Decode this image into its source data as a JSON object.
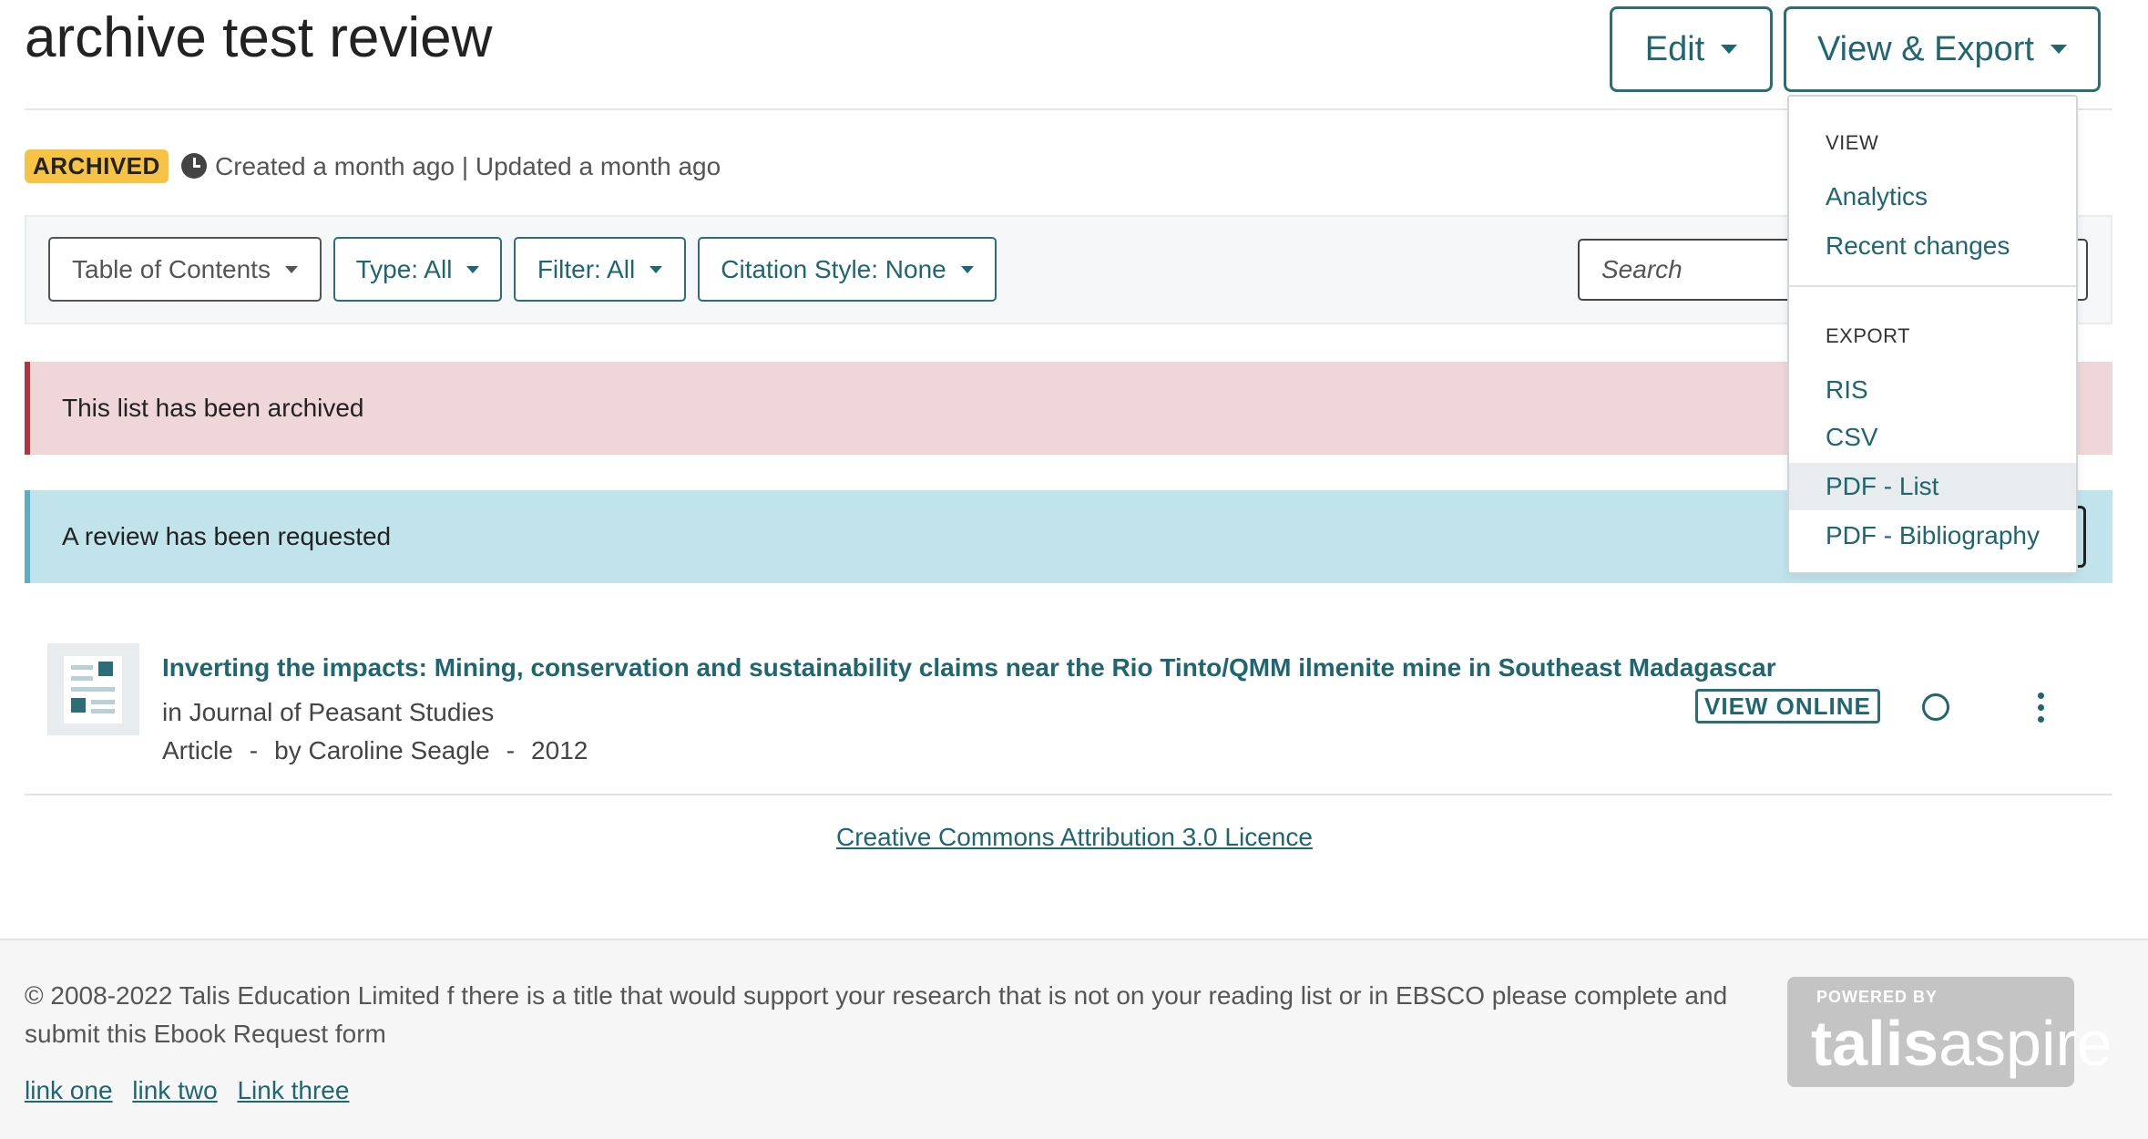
{
  "header": {
    "title": "archive test review",
    "edit_label": "Edit",
    "view_export_label": "View & Export"
  },
  "meta": {
    "badge": "ARCHIVED",
    "timestamps": "Created a month ago | Updated a month ago"
  },
  "toolbar": {
    "toc_label": "Table of Contents",
    "type_label": "Type: All",
    "filter_label": "Filter: All",
    "citation_label": "Citation Style: None",
    "search_placeholder": "Search"
  },
  "alerts": {
    "archived": "This list has been archived",
    "review": "A review has been requested"
  },
  "item": {
    "title": "Inverting the impacts: Mining, conservation and sustainability claims near the Rio Tinto/QMM ilmenite mine in Southeast Madagascar",
    "journal": "in Journal of Peasant Studies",
    "type": "Article",
    "author": "by Caroline Seagle",
    "year": "2012",
    "view_online": "VIEW ONLINE"
  },
  "licence": "Creative Commons Attribution 3.0 Licence",
  "footer": {
    "text": "© 2008-2022 Talis Education Limited f there is a title that would support your research that is not on your reading list or in EBSCO please complete and submit this Ebook Request form",
    "links": [
      "link one",
      "link two",
      "Link three"
    ],
    "logo_powered": "POWERED BY",
    "logo_talis": "talis",
    "logo_aspire": "aspire"
  },
  "dropdown": {
    "view_header": "VIEW",
    "view_items": [
      "Analytics",
      "Recent changes"
    ],
    "export_header": "EXPORT",
    "export_items": [
      "RIS",
      "CSV",
      "PDF - List",
      "PDF - Bibliography"
    ],
    "highlighted_item": "PDF - List"
  },
  "colors": {
    "accent": "#1f6670",
    "badge": "#f7c344",
    "archived_bg": "#efd6d8",
    "review_bg": "#c1e4ec"
  }
}
